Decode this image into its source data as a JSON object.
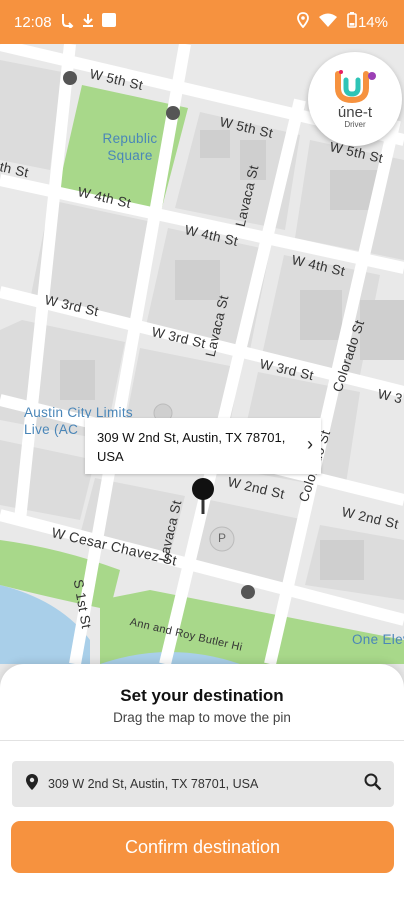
{
  "status_bar": {
    "time": "12:08",
    "battery": "14%",
    "icons": [
      "call-forward-icon",
      "download-icon",
      "app-square-icon",
      "location-icon",
      "wifi-icon",
      "battery-icon"
    ]
  },
  "logo": {
    "name": "úne-t",
    "subtitle": "Driver"
  },
  "map": {
    "streets": [
      "W 5th St",
      "W 5th St",
      "W 5th St",
      "th St",
      "W 4th St",
      "W 4th St",
      "W 4th St",
      "W 3rd St",
      "W 3rd St",
      "W 3rd St",
      "W 3",
      "W 2nd St",
      "W 2nd St",
      "W Cesar Chavez St",
      "Lavaca St",
      "Lavaca St",
      "Lavaca St",
      "Colorado St",
      "Colorado St",
      "S 1st St",
      "Ann and Roy Butler Hi"
    ],
    "places": [
      "Republic Square",
      "Austin City Limits Live (AC",
      "One Elev"
    ],
    "parking_label": "P"
  },
  "callout": {
    "address": "309 W 2nd St, Austin, TX 78701, USA"
  },
  "sheet": {
    "title": "Set your destination",
    "subtitle": "Drag the map to move the pin",
    "search_value": "309 W 2nd St, Austin, TX 78701, USA",
    "confirm_label": "Confirm destination"
  },
  "colors": {
    "accent": "#f6923f",
    "park": "#a8d88a",
    "water": "#a9cfe9"
  }
}
